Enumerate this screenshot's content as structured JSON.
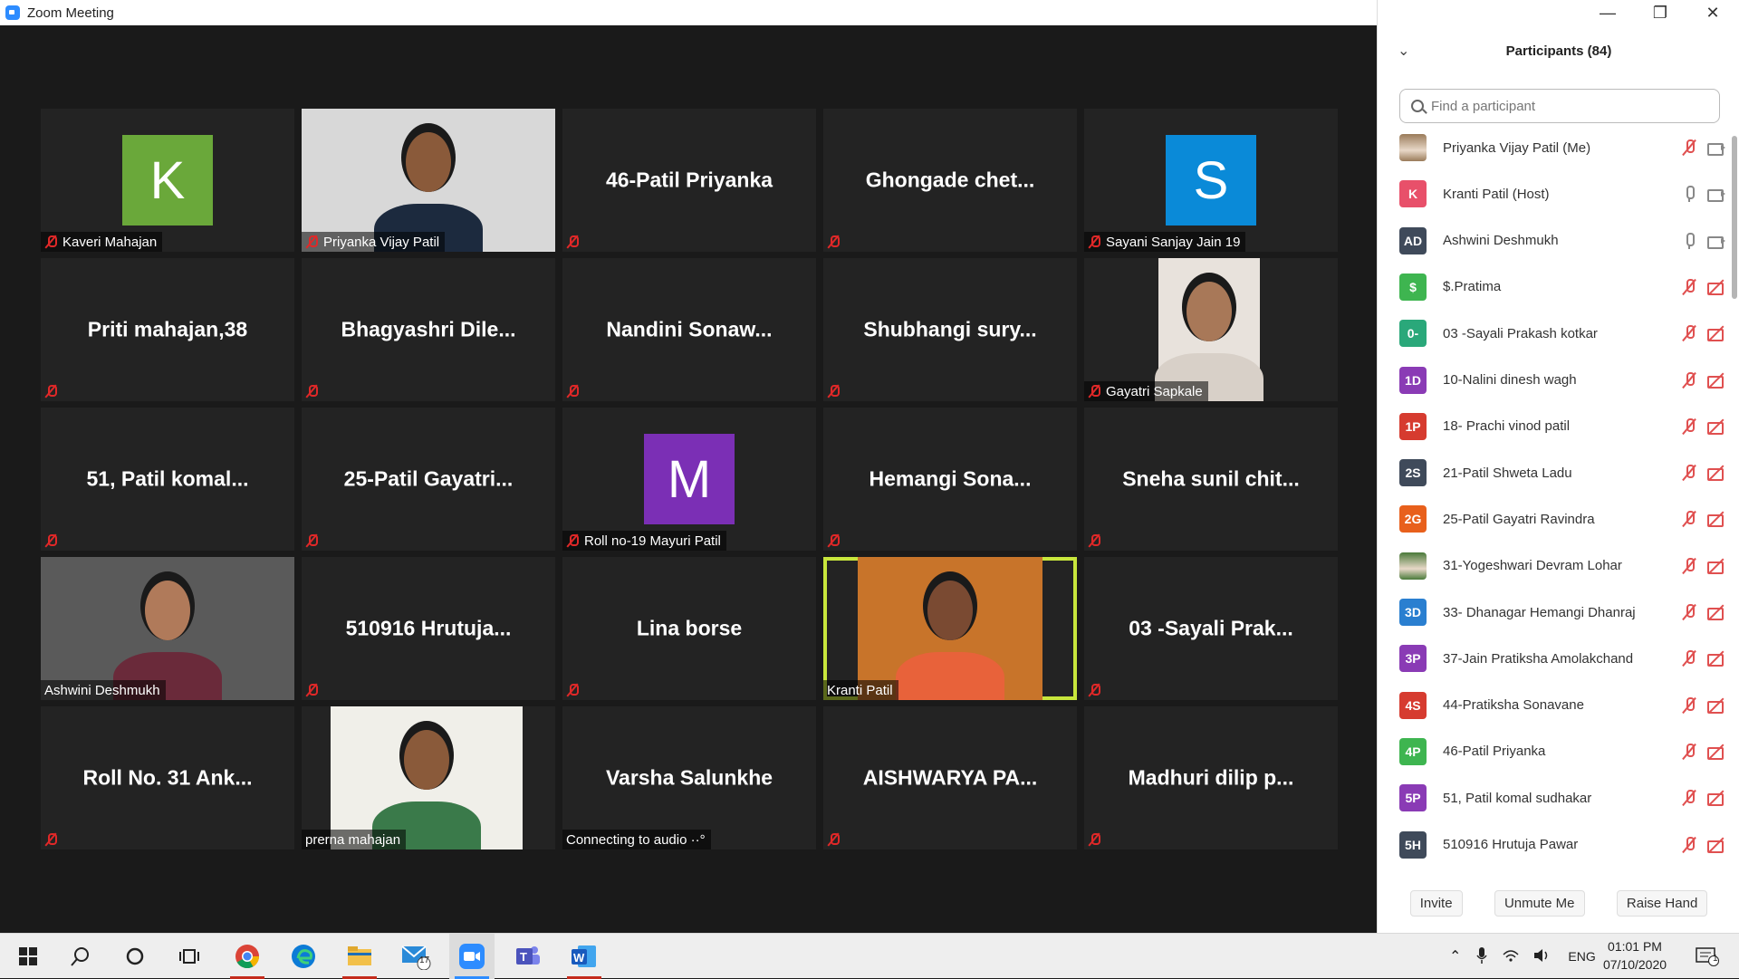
{
  "window": {
    "title": "Zoom Meeting"
  },
  "tiles": [
    {
      "name": "Kaveri Mahajan",
      "type": "avatar",
      "letter": "K",
      "color": "#6aa83a",
      "muted": true
    },
    {
      "name": "Priyanka Vijay Patil",
      "type": "video",
      "muted": true
    },
    {
      "big": "46-Patil Priyanka",
      "muted": true
    },
    {
      "big": "Ghongade  chet...",
      "muted": true
    },
    {
      "name": "Sayani Sanjay Jain 19",
      "type": "avatar",
      "letter": "S",
      "color": "#0a8ad8",
      "muted": true
    },
    {
      "big": "Priti mahajan,38",
      "muted": true
    },
    {
      "big": "Bhagyashri  Dile...",
      "muted": true
    },
    {
      "big": "Nandini Sonaw...",
      "muted": true
    },
    {
      "big": "Shubhangi sury...",
      "muted": true
    },
    {
      "name": "Gayatri Sapkale",
      "type": "photo",
      "muted": true
    },
    {
      "big": "51, Patil komal...",
      "muted": true
    },
    {
      "big": "25-Patil  Gayatri...",
      "muted": true
    },
    {
      "name": "Roll no-19 Mayuri Patil",
      "type": "avatar",
      "letter": "M",
      "color": "#7b2fb5",
      "muted": true
    },
    {
      "big": "Hemangi Sona...",
      "muted": true
    },
    {
      "big": "Sneha sunil chit...",
      "muted": true
    },
    {
      "name": "Ashwini Deshmukh",
      "type": "video",
      "muted": false
    },
    {
      "big": "510916  Hrutuja...",
      "muted": true
    },
    {
      "big": "Lina borse",
      "muted": true
    },
    {
      "name": "Kranti Patil",
      "type": "video",
      "muted": false,
      "active": true
    },
    {
      "big": "03 -Sayali  Prak...",
      "muted": true
    },
    {
      "big": "Roll No. 31  Ank...",
      "muted": true
    },
    {
      "name": "prerna mahajan",
      "type": "video",
      "muted": false
    },
    {
      "big": "Varsha Salunkhe",
      "label": "Connecting to audio ··°",
      "muted": false
    },
    {
      "big": "AISHWARYA PA...",
      "muted": true
    },
    {
      "big": "Madhuri dilip p...",
      "muted": true
    }
  ],
  "panel": {
    "title": "Participants (84)",
    "search_placeholder": "Find a participant",
    "participants": [
      {
        "initials": "",
        "color": "#9a7b5a",
        "name": "Priyanka Vijay Patil (Me)",
        "mic": "off",
        "cam": "on",
        "photo": true
      },
      {
        "initials": "K",
        "color": "#e8506a",
        "name": "Kranti Patil (Host)",
        "mic": "on",
        "cam": "on"
      },
      {
        "initials": "AD",
        "color": "#3f4a5a",
        "name": "Ashwini Deshmukh",
        "mic": "on",
        "cam": "on"
      },
      {
        "initials": "$",
        "color": "#3eb550",
        "name": "$.Pratima",
        "mic": "off",
        "cam": "off"
      },
      {
        "initials": "0-",
        "color": "#2aa87a",
        "name": "03 -Sayali  Prakash kotkar",
        "mic": "off",
        "cam": "off"
      },
      {
        "initials": "1D",
        "color": "#8a3bb5",
        "name": "10-Nalini dinesh wagh",
        "mic": "off",
        "cam": "off"
      },
      {
        "initials": "1P",
        "color": "#d63b2f",
        "name": "18- Prachi vinod patil",
        "mic": "off",
        "cam": "off"
      },
      {
        "initials": "2S",
        "color": "#3f4a5a",
        "name": "21-Patil Shweta Ladu",
        "mic": "off",
        "cam": "off"
      },
      {
        "initials": "2G",
        "color": "#e8601c",
        "name": "25-Patil Gayatri Ravindra",
        "mic": "off",
        "cam": "off"
      },
      {
        "initials": "",
        "color": "#4a7a3a",
        "name": "31-Yogeshwari Devram Lohar",
        "mic": "off",
        "cam": "off",
        "photo": true
      },
      {
        "initials": "3D",
        "color": "#2a7fd0",
        "name": "33- Dhanagar Hemangi Dhanraj",
        "mic": "off",
        "cam": "off"
      },
      {
        "initials": "3P",
        "color": "#8a3bb5",
        "name": "37-Jain Pratiksha Amolakchand",
        "mic": "off",
        "cam": "off"
      },
      {
        "initials": "4S",
        "color": "#d63b2f",
        "name": "44-Pratiksha Sonavane",
        "mic": "off",
        "cam": "off"
      },
      {
        "initials": "4P",
        "color": "#3eb550",
        "name": "46-Patil Priyanka",
        "mic": "off",
        "cam": "off"
      },
      {
        "initials": "5P",
        "color": "#8a3bb5",
        "name": "51, Patil komal sudhakar",
        "mic": "off",
        "cam": "off"
      },
      {
        "initials": "5H",
        "color": "#3f4a5a",
        "name": "510916 Hrutuja Pawar",
        "mic": "off",
        "cam": "off"
      }
    ],
    "footer": {
      "invite": "Invite",
      "unmute": "Unmute Me",
      "raise_hand": "Raise Hand"
    }
  },
  "taskbar": {
    "mail_badge": "17",
    "language": "ENG",
    "time": "01:01 PM",
    "date": "07/10/2020",
    "notification_count": "1"
  }
}
